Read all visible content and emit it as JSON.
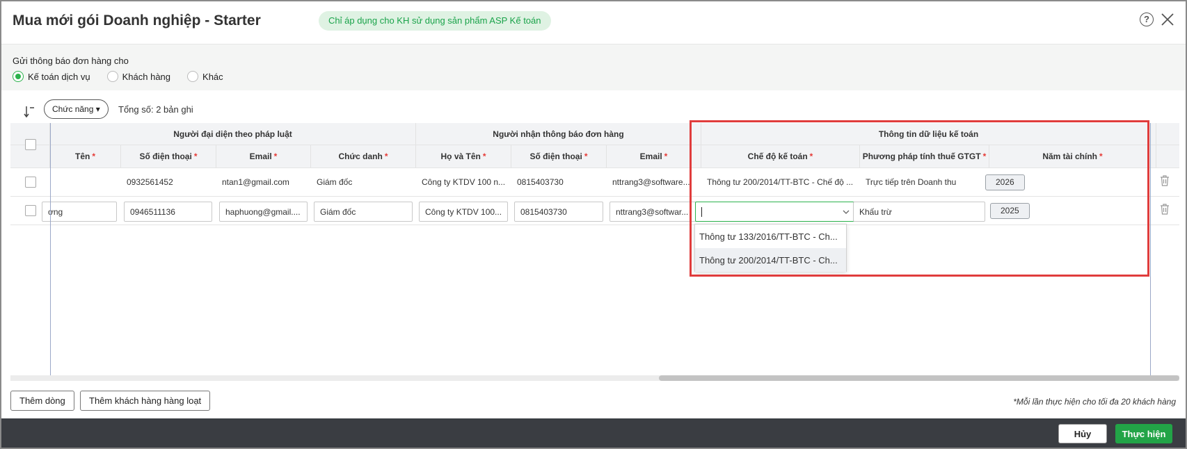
{
  "header": {
    "title": "Mua mới gói Doanh nghiệp - Starter",
    "badge": "Chỉ áp dụng cho KH sử dụng sản phẩm ASP Kế toán",
    "help_icon": "help-icon",
    "close_icon": "close-icon"
  },
  "notify": {
    "label": "Gửi thông báo đơn hàng cho",
    "options": [
      {
        "label": "Kế toán dịch vụ",
        "checked": true
      },
      {
        "label": "Khách hàng",
        "checked": false
      },
      {
        "label": "Khác",
        "checked": false
      }
    ]
  },
  "toolbar": {
    "function_button": "Chức năng",
    "total": "Tổng số: 2 bản ghi"
  },
  "table": {
    "groups": {
      "legal_rep": "Người đại diện theo pháp luật",
      "recipient": "Người nhận thông báo đơn hàng",
      "accounting": "Thông tin dữ liệu kế toán"
    },
    "columns": {
      "name": "Tên",
      "phone": "Số điện thoại",
      "email": "Email",
      "title": "Chức danh",
      "full_name": "Họ và Tên",
      "r_phone": "Số điện thoại",
      "r_email": "Email",
      "regime": "Chế độ kế toán",
      "vat": "Phương pháp tính thuế GTGT",
      "year": "Năm tài chính"
    },
    "required_mark": "*",
    "rows": [
      {
        "phone": "0932561452",
        "email": "ntan1@gmail.com",
        "title": "Giám đốc",
        "full_name": "Công ty KTDV 100 n...",
        "r_phone": "0815403730",
        "r_email": "nttrang3@software....",
        "regime": "Thông tư 200/2014/TT-BTC - Chế độ ...",
        "vat": "Trực tiếp trên Doanh thu",
        "year": "2026"
      },
      {
        "name": "ơng",
        "phone": "0946511136",
        "email": "haphuong@gmail....",
        "title": "Giám đốc",
        "full_name": "Công ty KTDV 100...",
        "r_phone": "0815403730",
        "r_email": "nttrang3@softwar...",
        "regime": "",
        "vat": "Khấu trừ",
        "year": "2025"
      }
    ]
  },
  "dropdown": {
    "options": [
      "Thông tư 133/2016/TT-BTC - Ch...",
      "Thông tư 200/2014/TT-BTC - Ch..."
    ]
  },
  "bottom": {
    "add_row": "Thêm dòng",
    "add_bulk": "Thêm khách hàng hàng loạt",
    "note": "*Mỗi lần thực hiện cho tối đa 20 khách hàng"
  },
  "footer": {
    "cancel": "Hủy",
    "submit": "Thực hiện"
  },
  "colors": {
    "accent_green": "#22a447",
    "highlight_red": "#e03c3c",
    "footer_bg": "#3a3d42"
  }
}
